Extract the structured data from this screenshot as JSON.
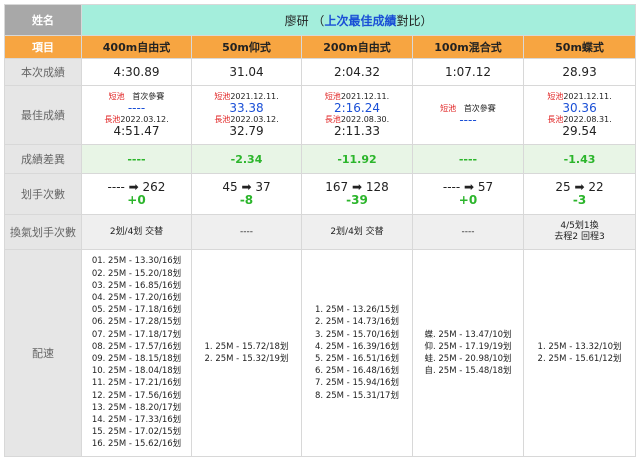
{
  "header": {
    "name_label": "姓名",
    "swimmer": "廖研",
    "paren_open": "（",
    "accent_text": "上次最佳成績",
    "suffix": "對比）"
  },
  "columns_header": {
    "label": "項目",
    "events": [
      "400m自由式",
      "50m仰式",
      "200m自由式",
      "100m混合式",
      "50m蝶式"
    ]
  },
  "rows": {
    "current_label": "本次成績",
    "best_label": "最佳成績",
    "diff_label": "成績差異",
    "strokes_label": "划手次數",
    "breath_label": "換氣划手次數",
    "pace_label": "配速"
  },
  "current": [
    "4:30.89",
    "31.04",
    "2:04.32",
    "1:07.12",
    "28.93"
  ],
  "best": [
    {
      "short_tag": "短池",
      "short_date": "首次參賽",
      "short_time": "----",
      "long_tag": "長池",
      "long_date": "2022.03.12.",
      "long_time": "4:51.47"
    },
    {
      "short_tag": "短池",
      "short_date": "2021.12.11.",
      "short_time": "33.38",
      "long_tag": "長池",
      "long_date": "2022.03.12.",
      "long_time": "32.79"
    },
    {
      "short_tag": "短池",
      "short_date": "2021.12.11.",
      "short_time": "2:16.24",
      "long_tag": "長池",
      "long_date": "2022.08.30.",
      "long_time": "2:11.33"
    },
    {
      "short_tag": "短池",
      "short_date": "首次參賽",
      "short_time": "----",
      "long_tag": "",
      "long_date": "",
      "long_time": ""
    },
    {
      "short_tag": "短池",
      "short_date": "2021.12.11.",
      "short_time": "30.36",
      "long_tag": "長池",
      "long_date": "2022.08.31.",
      "long_time": "29.54"
    }
  ],
  "diff": [
    "----",
    "-2.34",
    "-11.92",
    "----",
    "-1.43"
  ],
  "strokes": [
    {
      "line": "---- ➡ 262",
      "diff": "+0"
    },
    {
      "line": "45 ➡ 37",
      "diff": "-8"
    },
    {
      "line": "167 ➡ 128",
      "diff": "-39"
    },
    {
      "line": "---- ➡ 57",
      "diff": "+0"
    },
    {
      "line": "25 ➡ 22",
      "diff": "-3"
    }
  ],
  "breath": [
    {
      "line1": "2划/4划 交替",
      "line2": ""
    },
    {
      "line1": "----",
      "line2": ""
    },
    {
      "line1": "2划/4划 交替",
      "line2": ""
    },
    {
      "line1": "----",
      "line2": ""
    },
    {
      "line1": "4/5划1換",
      "line2": "去程2 回程3"
    }
  ],
  "pace": [
    [
      "01. 25M - 13.30/16划",
      "02. 25M - 15.20/18划",
      "03. 25M - 16.85/16划",
      "04. 25M - 17.20/16划",
      "05. 25M - 17.18/16划",
      "06. 25M - 17.28/15划",
      "07. 25M - 17.18/17划",
      "08. 25M - 17.57/16划",
      "09. 25M - 18.15/18划",
      "10. 25M - 18.04/18划",
      "11. 25M - 17.21/16划",
      "12. 25M - 17.56/16划",
      "13. 25M - 18.20/17划",
      "14. 25M - 17.33/16划",
      "15. 25M - 17.02/15划",
      "16. 25M - 15.62/16划"
    ],
    [
      "1. 25M - 15.72/18划",
      "2. 25M - 15.32/19划"
    ],
    [
      "1. 25M - 13.26/15划",
      "2. 25M - 14.73/16划",
      "3. 25M - 15.70/16划",
      "4. 25M - 16.39/16划",
      "5. 25M - 16.51/16划",
      "6. 25M - 16.48/16划",
      "7. 25M - 15.94/16划",
      "8. 25M - 15.31/17划"
    ],
    [
      "蝶. 25M - 13.47/10划",
      "仰. 25M - 17.19/19划",
      "蛙. 25M - 20.98/10划",
      "自. 25M - 15.48/18划"
    ],
    [
      "1. 25M - 13.32/10划",
      "2. 25M - 15.61/12划"
    ]
  ],
  "colors": {
    "header_bg": "#a4eedc",
    "orange": "#f7a541",
    "green": "#2bb52b",
    "blue": "#1a4fd6",
    "red": "#e02020"
  }
}
